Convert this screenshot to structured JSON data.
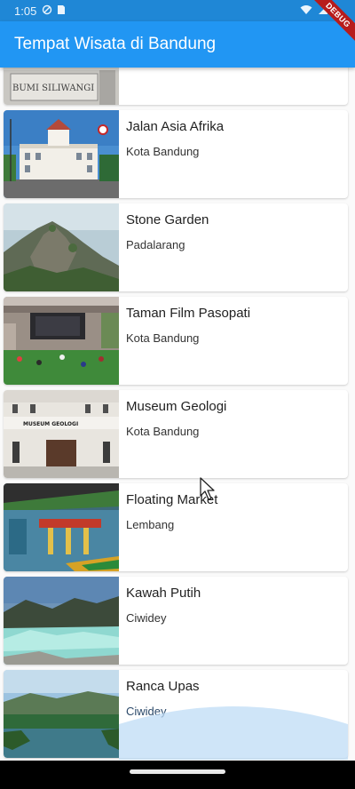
{
  "status_bar": {
    "time": "1:05"
  },
  "debug_banner": "DEBUG",
  "app_bar": {
    "title": "Tempat Wisata di Bandung"
  },
  "places": [
    {
      "name": "",
      "location": ""
    },
    {
      "name": "Jalan Asia Afrika",
      "location": "Kota Bandung"
    },
    {
      "name": "Stone Garden",
      "location": "Padalarang"
    },
    {
      "name": "Taman Film Pasopati",
      "location": "Kota Bandung"
    },
    {
      "name": "Museum Geologi",
      "location": "Kota Bandung"
    },
    {
      "name": "Floating Market",
      "location": "Lembang"
    },
    {
      "name": "Kawah Putih",
      "location": "Ciwidey"
    },
    {
      "name": "Ranca Upas",
      "location": "Ciwidey"
    }
  ],
  "thumb_texts": {
    "bumi_siliwangi": "BUMI SILIWANGI",
    "museum_geologi": "MUSEUM GEOLOGI"
  },
  "colors": {
    "app_bar": "#2196f3",
    "status_bar": "#1f87d6",
    "background": "#fafafa"
  }
}
